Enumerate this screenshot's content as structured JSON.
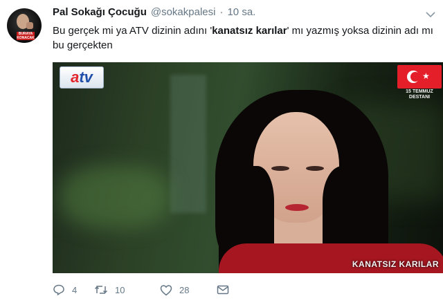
{
  "user": {
    "name": "Pal Sokağı Çocuğu",
    "handle": "@sokakpalesi",
    "separator": "·",
    "time": "10 sa.",
    "avatar_sticker_text": "BURAYA KONACAK"
  },
  "tweet": {
    "text_part1": "Bu gerçek mi ya ATV dizinin adını '",
    "text_bold": "kanatsız karılar",
    "text_part2": "' mı yazmış yoksa dizinin adı mı bu gerçekten"
  },
  "media": {
    "channel_logo_a": "a",
    "channel_logo_tv": "tv",
    "flag_caption_line1": "15 TEMMUZ",
    "flag_caption_line2": "DESTANI",
    "show_title": "KANATSIZ KARILAR"
  },
  "actions": {
    "reply_count": "4",
    "retweet_count": "10",
    "like_count": "28"
  },
  "colors": {
    "text": "#14171a",
    "secondary": "#657786",
    "flag_red": "#e41f2a"
  },
  "icons": [
    "caret-down-icon",
    "reply-icon",
    "retweet-icon",
    "like-icon",
    "message-icon"
  ]
}
